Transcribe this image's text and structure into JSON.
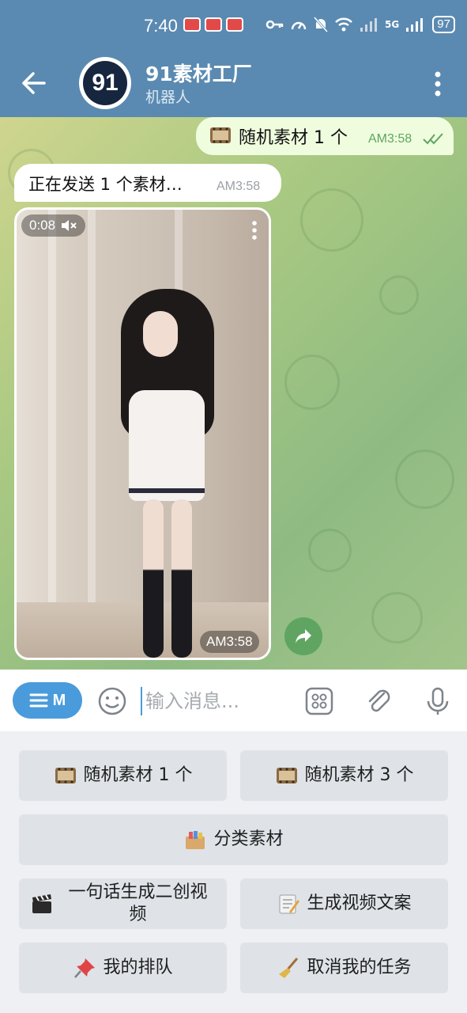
{
  "status_bar": {
    "time": "7:40",
    "battery": "97",
    "network": "5G"
  },
  "header": {
    "title": "91素材工厂",
    "subtitle": "机器人",
    "avatar_text": "91"
  },
  "messages": {
    "outgoing": {
      "text": "随机素材 1 个",
      "time": "AM3:58"
    },
    "incoming": {
      "text": "正在发送 1 个素材…",
      "time": "AM3:58"
    },
    "video": {
      "duration": "0:08",
      "time": "AM3:58"
    }
  },
  "input_bar": {
    "menu_label": "M",
    "placeholder": "输入消息..."
  },
  "keyboard": {
    "buttons": [
      {
        "label": "随机素材 1 个",
        "icon": "film-reel-icon"
      },
      {
        "label": "随机素材 3 个",
        "icon": "film-reel-icon"
      },
      {
        "label": "分类素材",
        "icon": "card-box-icon"
      },
      {
        "label": "一句话生成二创视频",
        "icon": "clapper-icon"
      },
      {
        "label": "生成视频文案",
        "icon": "memo-icon"
      },
      {
        "label": "我的排队",
        "icon": "pushpin-icon"
      },
      {
        "label": "取消我的任务",
        "icon": "broom-icon"
      }
    ]
  },
  "colors": {
    "header": "#5a8ab1",
    "accent": "#4a9bdb",
    "outgoing_bubble": "#effdde",
    "check_green": "#5fa561"
  }
}
